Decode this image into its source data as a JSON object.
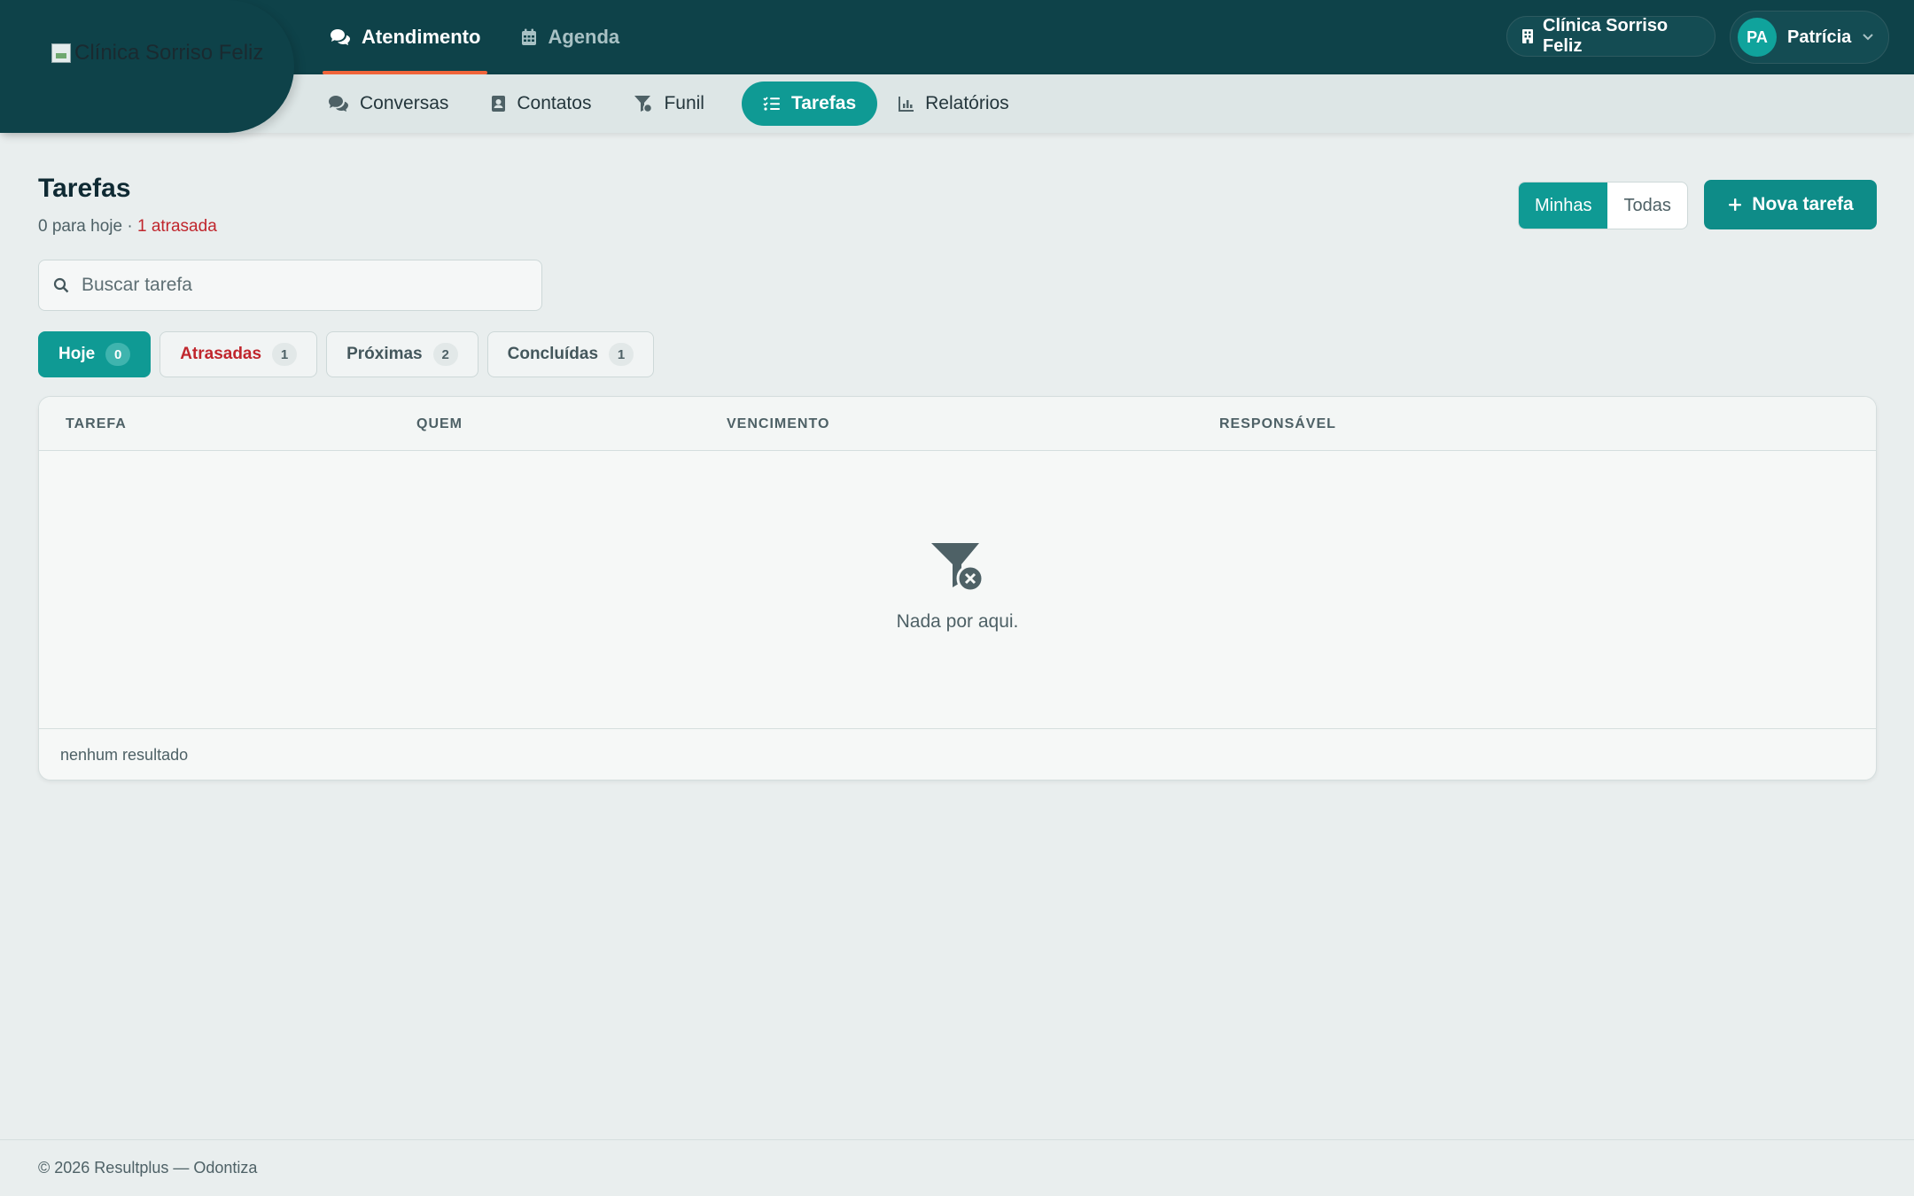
{
  "header": {
    "logo_alt": "Clínica Sorriso Feliz",
    "main_tabs": [
      {
        "label": "Atendimento",
        "icon": "comments-icon",
        "active": true
      },
      {
        "label": "Agenda",
        "icon": "calendar-icon",
        "active": false
      }
    ],
    "sub_tabs": [
      {
        "label": "Conversas",
        "icon": "comments-icon",
        "active": false
      },
      {
        "label": "Contatos",
        "icon": "address-book-icon",
        "active": false
      },
      {
        "label": "Funil",
        "icon": "funnel-icon",
        "active": false
      },
      {
        "label": "Tarefas",
        "icon": "list-check-icon",
        "active": true
      },
      {
        "label": "Relatórios",
        "icon": "chart-icon",
        "active": false
      }
    ],
    "clinic": "Clínica Sorriso Feliz",
    "user": {
      "initials": "PA",
      "name": "Patrícia"
    }
  },
  "page": {
    "title": "Tarefas",
    "summary_today": "0 para hoje · ",
    "summary_late": "1 atrasada",
    "segment": {
      "mine": "Minhas",
      "all": "Todas",
      "selected": "Minhas"
    },
    "new_button": "Nova tarefa"
  },
  "search": {
    "placeholder": "Buscar tarefa",
    "value": ""
  },
  "filters": [
    {
      "label": "Hoje",
      "count": "0",
      "active": true
    },
    {
      "label": "Atrasadas",
      "count": "1",
      "active": false
    },
    {
      "label": "Próximas",
      "count": "2",
      "active": false
    },
    {
      "label": "Concluídas",
      "count": "1",
      "active": false
    }
  ],
  "table": {
    "columns": [
      "TAREFA",
      "QUEM",
      "VENCIMENTO",
      "RESPONSÁVEL"
    ],
    "rows": [],
    "empty_text": "Nada por aqui.",
    "footer": "nenhum resultado"
  },
  "footer": {
    "text": "© 2026 Resultplus — Odontiza"
  },
  "colors": {
    "primary": "#0f9a94",
    "navbar": "#0e4249",
    "accent": "#f0643a",
    "danger": "#c0262d"
  }
}
